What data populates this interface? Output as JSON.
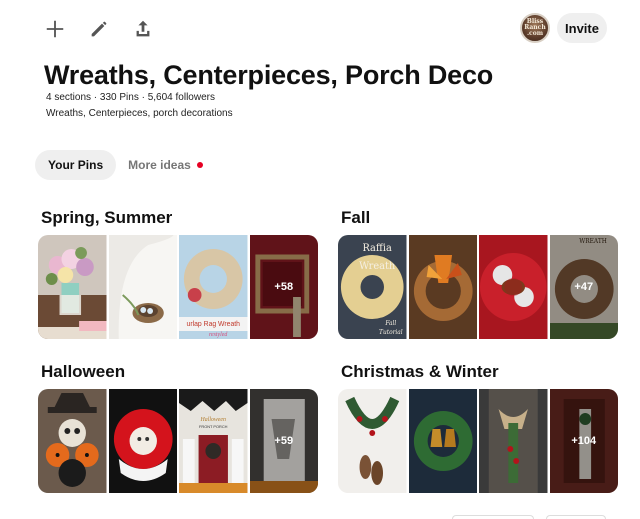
{
  "toolbar": {
    "add_icon": "plus-icon",
    "edit_icon": "pencil-icon",
    "share_icon": "upload-icon"
  },
  "header": {
    "avatar_text": "Bliss Ranch .com",
    "invite_label": "Invite"
  },
  "board": {
    "title": "Wreaths, Centerpieces, Porch Deco",
    "stats": "4 sections · 330 Pins · 5,604 followers",
    "description": "Wreaths, Centerpieces, porch decorations"
  },
  "tabs": {
    "your_pins": "Your Pins",
    "more_ideas": "More ideas"
  },
  "sections": [
    {
      "title": "Spring, Summer",
      "more": "+58"
    },
    {
      "title": "Fall",
      "more": "+47"
    },
    {
      "title": "Halloween",
      "more": "+59"
    },
    {
      "title": "Christmas & Winter",
      "more": "+104"
    }
  ],
  "thumb_text": {
    "burlap": "urlap Rag Wreath",
    "burlap_sub": "restyled",
    "raffia_1": "Raffia",
    "raffia_2": "Wreath",
    "raffia_3": "Fall",
    "raffia_4": "Tutorial",
    "wreath_label": "WREATH",
    "halloween_1": "Halloween",
    "halloween_2": "FRONT PORCH"
  },
  "colors": {
    "accent_dot": "#e60023",
    "pill_bg": "#efefef",
    "muted_text": "#767676"
  }
}
